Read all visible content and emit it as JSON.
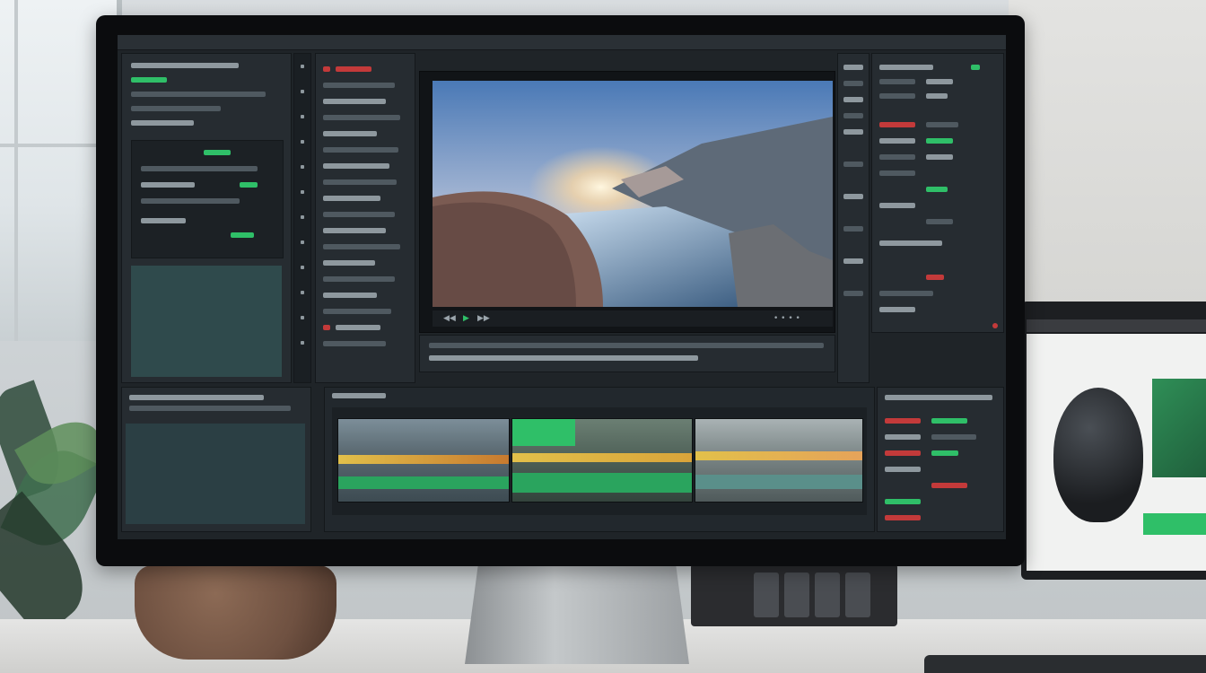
{
  "scene": {
    "description_tags": [
      "monitor-with-video-editor",
      "second-monitor",
      "plant",
      "desk"
    ],
    "colors": {
      "ui_bg": "#1f2428",
      "panel": "#262c31",
      "accent_green": "#2fbf68",
      "accent_red": "#c33a3a",
      "accent_yellow": "#e2c04a"
    },
    "icons": [
      "play-icon",
      "pause-icon",
      "step-back-icon",
      "step-forward-icon"
    ]
  },
  "viewer": {
    "controls": {
      "play": "▶",
      "back": "◀◀",
      "forward": "▶▶",
      "dots": "• • • •"
    }
  }
}
